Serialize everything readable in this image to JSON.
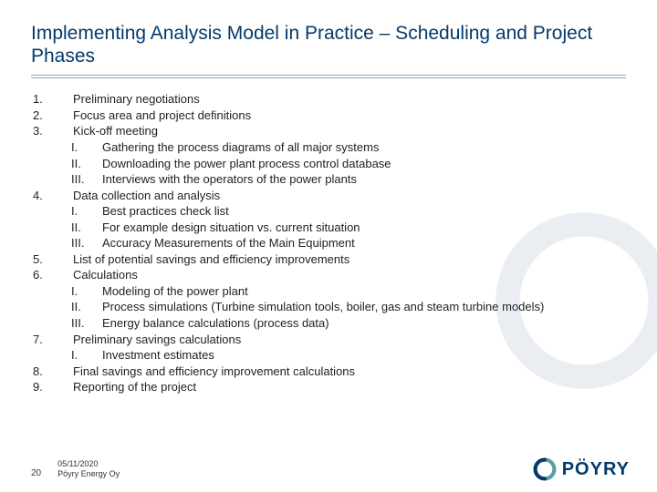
{
  "title": "Implementing Analysis Model in Practice – Scheduling and Project Phases",
  "items": [
    {
      "num": "1.",
      "text": "Preliminary negotiations",
      "sub": []
    },
    {
      "num": "2.",
      "text": "Focus area and project definitions",
      "sub": []
    },
    {
      "num": "3.",
      "text": "Kick-off meeting",
      "sub": [
        {
          "roman": "I.",
          "text": "Gathering the process diagrams of all major systems"
        },
        {
          "roman": "II.",
          "text": "Downloading the power plant process control database"
        },
        {
          "roman": "III.",
          "text": "Interviews with the operators of the power plants"
        }
      ]
    },
    {
      "num": "4.",
      "text": "Data collection and analysis",
      "sub": [
        {
          "roman": "I.",
          "text": "Best practices check list"
        },
        {
          "roman": "II.",
          "text": "For example design situation vs. current situation"
        },
        {
          "roman": "III.",
          "text": "Accuracy Measurements of the Main Equipment"
        }
      ]
    },
    {
      "num": "5.",
      "text": "List of potential savings and efficiency improvements",
      "sub": []
    },
    {
      "num": "6.",
      "text": "Calculations",
      "sub": [
        {
          "roman": "I.",
          "text": "Modeling of the power plant"
        },
        {
          "roman": "II.",
          "text": "Process simulations (Turbine simulation tools, boiler, gas and steam turbine models)"
        },
        {
          "roman": "III.",
          "text": "Energy balance calculations (process data)"
        }
      ]
    },
    {
      "num": "7.",
      "text": "Preliminary savings calculations",
      "sub": [
        {
          "roman": "I.",
          "text": "Investment estimates"
        }
      ]
    },
    {
      "num": "8.",
      "text": "Final savings and efficiency improvement calculations",
      "sub": []
    },
    {
      "num": "9.",
      "text": "Reporting of the project",
      "sub": []
    }
  ],
  "footer": {
    "page": "20",
    "date": "05/11/2020",
    "company": "Pöyry Energy Oy"
  },
  "logo": {
    "text": "PÖYRY"
  }
}
